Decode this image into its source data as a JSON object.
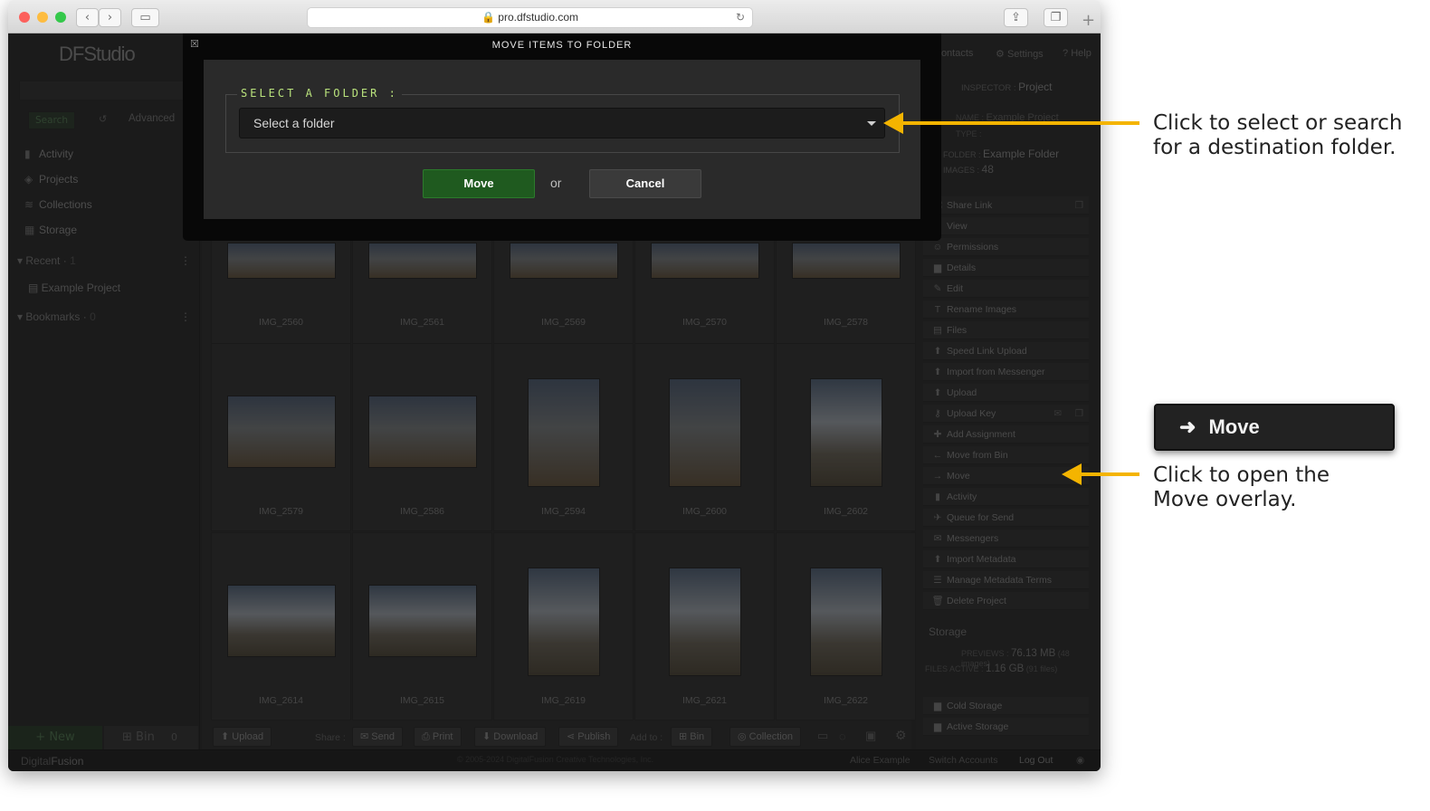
{
  "browser": {
    "url": "pro.dfstudio.com"
  },
  "app": {
    "logo": "DFStudio",
    "top_nav": [
      "Contacts",
      "Settings",
      "Help"
    ],
    "search": {
      "button": "Search",
      "advanced": "Advanced"
    },
    "left_nav": [
      {
        "label": "Activity",
        "icon": "bar-chart-icon"
      },
      {
        "label": "Projects",
        "icon": "layers-icon"
      },
      {
        "label": "Collections",
        "icon": "stack-icon"
      },
      {
        "label": "Storage",
        "icon": "grid-icon"
      }
    ],
    "recent": {
      "label": "Recent",
      "count": "1",
      "items": [
        "Example Project"
      ]
    },
    "bookmarks": {
      "label": "Bookmarks",
      "count": "0"
    },
    "left_bottom": {
      "new_label": "+ New",
      "bin_label": "Bin",
      "bin_count": "0"
    },
    "grid": {
      "rows": [
        [
          "IMG_2560",
          "IMG_2561",
          "IMG_2569",
          "IMG_2570",
          "IMG_2578"
        ],
        [
          "IMG_2579",
          "IMG_2586",
          "IMG_2594",
          "IMG_2600",
          "IMG_2602"
        ],
        [
          "IMG_2614",
          "IMG_2615",
          "IMG_2619",
          "IMG_2621",
          "IMG_2622"
        ]
      ]
    },
    "toolbar": {
      "upload": "Upload",
      "share_label": "Share :",
      "send": "Send",
      "print": "Print",
      "download": "Download",
      "publish": "Publish",
      "add_to_label": "Add to :",
      "bin": "Bin",
      "collection": "Collection"
    },
    "inspector": {
      "label": "INSPECTOR :",
      "title": "Project",
      "name_label": "NAME :",
      "name": "Example Project",
      "type_label": "TYPE :",
      "folder_label": "FOLDER :",
      "folder": "Example Folder",
      "images_label": "IMAGES :",
      "images": "48"
    },
    "actions": [
      {
        "label": "Share Link",
        "icon": "link-icon"
      },
      {
        "label": "View",
        "icon": "eye-icon"
      },
      {
        "label": "Permissions",
        "icon": "users-icon"
      },
      {
        "label": "Details",
        "icon": "doc-icon"
      },
      {
        "label": "Edit",
        "icon": "pencil-icon"
      },
      {
        "label": "Rename Images",
        "icon": "rename-icon"
      },
      {
        "label": "Files",
        "icon": "files-icon"
      },
      {
        "label": "Speed Link Upload",
        "icon": "upload-icon"
      },
      {
        "label": "Import from Messenger",
        "icon": "upload-icon"
      },
      {
        "label": "Upload",
        "icon": "upload-icon"
      },
      {
        "label": "Upload Key",
        "icon": "key-icon"
      },
      {
        "label": "Add Assignment",
        "icon": "assignment-icon"
      },
      {
        "label": "Move from Bin",
        "icon": "arrow-left-icon"
      },
      {
        "label": "Move",
        "icon": "arrow-right-icon"
      },
      {
        "label": "Activity",
        "icon": "bar-chart-icon"
      },
      {
        "label": "Queue for Send",
        "icon": "send-icon"
      },
      {
        "label": "Messengers",
        "icon": "envelope-icon"
      },
      {
        "label": "Import Metadata",
        "icon": "upload-icon"
      },
      {
        "label": "Manage Metadata Terms",
        "icon": "list-icon"
      },
      {
        "label": "Delete Project",
        "icon": "trash-icon"
      }
    ],
    "storage": {
      "heading": "Storage",
      "previews_label": "PREVIEWS :",
      "previews": "76.13 MB",
      "previews_note": "(48 images)",
      "files_label": "FILES ACTIVE :",
      "files": "1.16 GB",
      "files_note": "(91 files)",
      "cold": "Cold Storage",
      "active": "Active Storage"
    },
    "footer": {
      "brand_a": "Digital",
      "brand_b": "Fusion",
      "copyright": "© 2005-2024 DigitalFusion Creative Technologies, Inc.",
      "user": "Alice Example",
      "switch": "Switch Accounts",
      "logout": "Log Out"
    }
  },
  "modal": {
    "title": "MOVE ITEMS TO FOLDER",
    "legend": "SELECT A FOLDER :",
    "select_placeholder": "Select a folder",
    "move": "Move",
    "or": "or",
    "cancel": "Cancel"
  },
  "annotations": {
    "select_line1": "Click to select or search",
    "select_line2": "for a destination folder.",
    "callout_label": "Move",
    "move_line1": "Click to open the",
    "move_line2": "Move overlay."
  },
  "colors": {
    "accent_green": "#b9e27c",
    "move_button": "#1f5a1f",
    "arrow": "#f4b400"
  }
}
